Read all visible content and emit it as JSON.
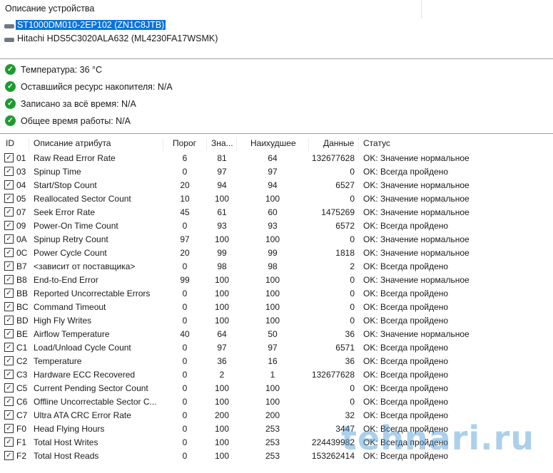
{
  "devices": {
    "title": "Описание устройства",
    "items": [
      {
        "label": "ST1000DM010-2EP102 (ZN1C8JTB)",
        "selected": true
      },
      {
        "label": "Hitachi HDS5C3020ALA632 (ML4230FA17WSMK)",
        "selected": false
      }
    ]
  },
  "summary": [
    "Температура: 36 °C",
    "Оставшийся ресурс накопителя: N/A",
    "Записано за всё время: N/A",
    "Общее время работы: N/A"
  ],
  "table": {
    "headers": {
      "id": "ID",
      "name": "Описание атрибута",
      "threshold": "Порог",
      "value": "Зна...",
      "worst": "Наихудшее",
      "data": "Данные",
      "status": "Статус"
    },
    "rows": [
      [
        "01",
        "Raw Read Error Rate",
        "6",
        "81",
        "64",
        "132677628",
        "OK: Значение нормальное"
      ],
      [
        "03",
        "Spinup Time",
        "0",
        "97",
        "97",
        "0",
        "OK: Всегда пройдено"
      ],
      [
        "04",
        "Start/Stop Count",
        "20",
        "94",
        "94",
        "6527",
        "OK: Значение нормальное"
      ],
      [
        "05",
        "Reallocated Sector Count",
        "10",
        "100",
        "100",
        "0",
        "OK: Значение нормальное"
      ],
      [
        "07",
        "Seek Error Rate",
        "45",
        "61",
        "60",
        "1475269",
        "OK: Значение нормальное"
      ],
      [
        "09",
        "Power-On Time Count",
        "0",
        "93",
        "93",
        "6572",
        "OK: Всегда пройдено"
      ],
      [
        "0A",
        "Spinup Retry Count",
        "97",
        "100",
        "100",
        "0",
        "OK: Значение нормальное"
      ],
      [
        "0C",
        "Power Cycle Count",
        "20",
        "99",
        "99",
        "1818",
        "OK: Значение нормальное"
      ],
      [
        "B7",
        "<зависит от поставщика>",
        "0",
        "98",
        "98",
        "2",
        "OK: Всегда пройдено"
      ],
      [
        "B8",
        "End-to-End Error",
        "99",
        "100",
        "100",
        "0",
        "OK: Значение нормальное"
      ],
      [
        "BB",
        "Reported Uncorrectable Errors",
        "0",
        "100",
        "100",
        "0",
        "OK: Всегда пройдено"
      ],
      [
        "BC",
        "Command Timeout",
        "0",
        "100",
        "100",
        "0",
        "OK: Всегда пройдено"
      ],
      [
        "BD",
        "High Fly Writes",
        "0",
        "100",
        "100",
        "0",
        "OK: Всегда пройдено"
      ],
      [
        "BE",
        "Airflow Temperature",
        "40",
        "64",
        "50",
        "36",
        "OK: Значение нормальное"
      ],
      [
        "C1",
        "Load/Unload Cycle Count",
        "0",
        "97",
        "97",
        "6571",
        "OK: Всегда пройдено"
      ],
      [
        "C2",
        "Temperature",
        "0",
        "36",
        "16",
        "36",
        "OK: Всегда пройдено"
      ],
      [
        "C3",
        "Hardware ECC Recovered",
        "0",
        "2",
        "1",
        "132677628",
        "OK: Всегда пройдено"
      ],
      [
        "C5",
        "Current Pending Sector Count",
        "0",
        "100",
        "100",
        "0",
        "OK: Всегда пройдено"
      ],
      [
        "C6",
        "Offline Uncorrectable Sector C...",
        "0",
        "100",
        "100",
        "0",
        "OK: Всегда пройдено"
      ],
      [
        "C7",
        "Ultra ATA CRC Error Rate",
        "0",
        "200",
        "200",
        "32",
        "OK: Всегда пройдено"
      ],
      [
        "F0",
        "Head Flying Hours",
        "0",
        "100",
        "253",
        "3447",
        "OK: Всегда пройдено"
      ],
      [
        "F1",
        "Total Host Writes",
        "0",
        "100",
        "253",
        "224439982",
        "OK: Всегда пройдено"
      ],
      [
        "F2",
        "Total Host Reads",
        "0",
        "100",
        "253",
        "153262414",
        "OK: Всегда пройдено"
      ]
    ]
  },
  "watermark": "tehnari.ru"
}
